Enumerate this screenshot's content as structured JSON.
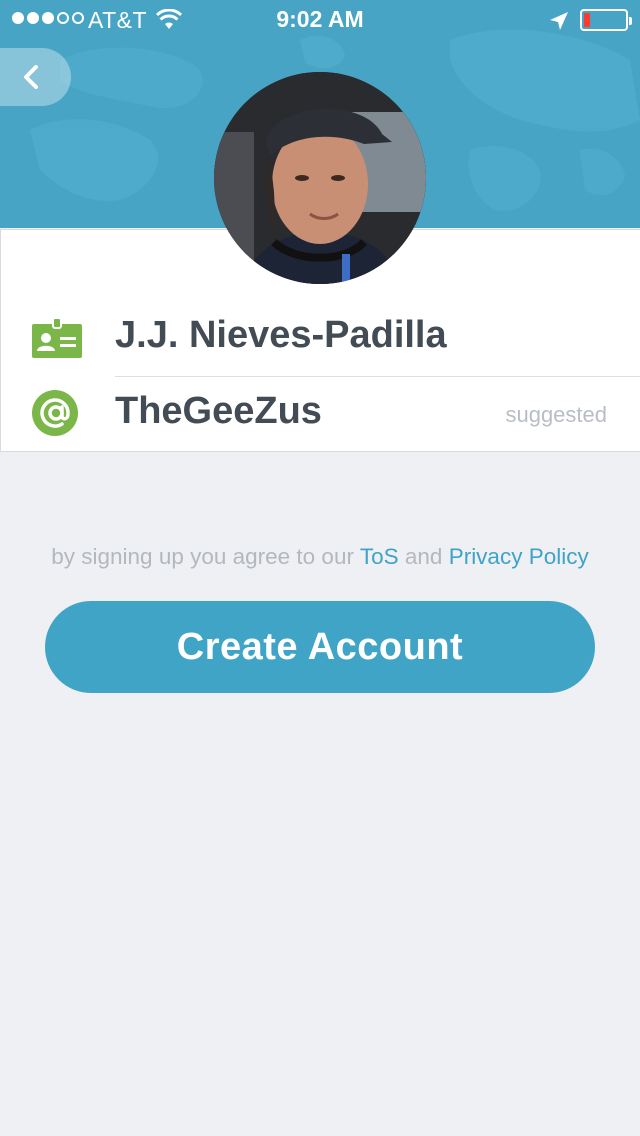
{
  "status_bar": {
    "carrier": "AT&T",
    "time": "9:02 AM",
    "signal_bars_filled": 3,
    "signal_bars_total": 5
  },
  "header": {
    "background_color": "#47a4c5",
    "back_icon": "chevron-left-icon"
  },
  "profile": {
    "avatar": "user-photo"
  },
  "form": {
    "full_name": "J.J. Nieves-Padilla",
    "name_icon": "id-card-icon",
    "username": "TheGeeZus",
    "username_icon": "at-sign-icon",
    "username_hint": "suggested",
    "icon_color": "#7ab648"
  },
  "terms": {
    "prefix": "by signing up you agree to our",
    "tos_link": "ToS",
    "conjunction": "and",
    "privacy_link": "Privacy Policy",
    "link_color": "#3ea3c8"
  },
  "cta": {
    "label": "Create Account",
    "color": "#3fa4c6"
  }
}
